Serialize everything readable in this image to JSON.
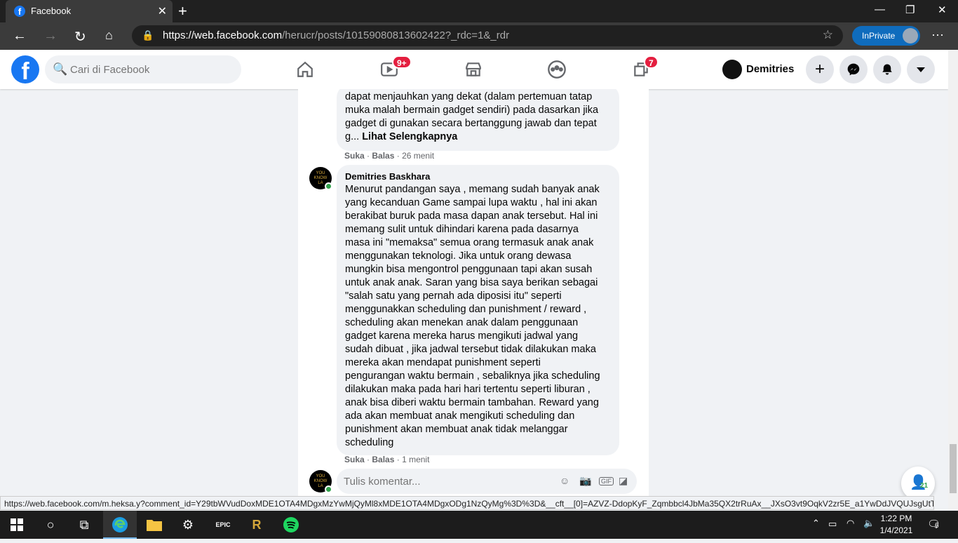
{
  "browser": {
    "tab_title": "Facebook",
    "url_domain": "https://web.facebook.com",
    "url_path": "/herucr/posts/10159080813602422?_rdc=1&_rdr",
    "inprivate_label": "InPrivate"
  },
  "facebook": {
    "search_placeholder": "Cari di Facebook",
    "video_badge": "9+",
    "pages_badge": "7",
    "profile_name": "Demitries"
  },
  "comments": [
    {
      "text": "dapat menjauhkan yang dekat (dalam pertemuan tatap\nmuka malah bermain gadget sendiri) pada dasarkan jika\ngadget di gunakan secara bertanggung jawab dan tepat\ng... ",
      "see_more": "Lihat Selengkapnya",
      "like": "Suka",
      "reply": "Balas",
      "time": "26 menit"
    },
    {
      "name": "Demitries Baskhara",
      "text": "Menurut pandangan saya , memang sudah banyak anak\nyang kecanduan Game sampai lupa waktu , hal ini akan\nberakibat buruk pada masa dapan anak tersebut. Hal ini\nmemang sulit untuk dihindari karena pada dasarnya\nmasa ini \"memaksa\" semua orang termasuk anak anak\nmenggunakan teknologi. Jika untuk orang dewasa\nmungkin bisa mengontrol penggunaan tapi akan susah\nuntuk anak anak. Saran yang bisa saya berikan sebagai\n\"salah satu yang pernah ada diposisi itu\" seperti\nmenggunakkan scheduling dan punishment / reward ,\nscheduling akan menekan anak dalam penggunaan\ngadget karena mereka harus mengikuti jadwal yang\nsudah dibuat , jika jadwal tersebut tidak dilakukan maka\nmereka akan mendapat punishment seperti\npengurangan waktu bermain , sebaliknya jika scheduling\ndilakukan maka pada hari hari tertentu seperti liburan ,\nanak bisa diberi waktu bermain tambahan. Reward yang\nada akan membuat anak mengikuti scheduling dan\npunishment akan membuat anak tidak melanggar\nscheduling",
      "like": "Suka",
      "reply": "Balas",
      "time": "1 menit"
    }
  ],
  "avatar_text": "YOU\nKNOW\nLA",
  "comment_input_placeholder": "Tulis komentar...",
  "contacts_count": "21",
  "status_url": "https://web.facebook.com/m.heksa.y?comment_id=Y29tbWVudDoxMDE1OTA4MDgxMzYwMjQyMl8xMDE1OTA4MDgxODg1NzQyMg%3D%3D&__cft__[0]=AZVZ-DdopKyF_Zqmbbcl4JbMa35QX2trRuAx__JXsO3vt9OqkV2zr5E_a1YwDdJVQUJsgUtTmJQ...",
  "taskbar": {
    "time": "1:22 PM",
    "date": "1/4/2021",
    "notif_count": "6",
    "epic_label": "EPIC"
  }
}
